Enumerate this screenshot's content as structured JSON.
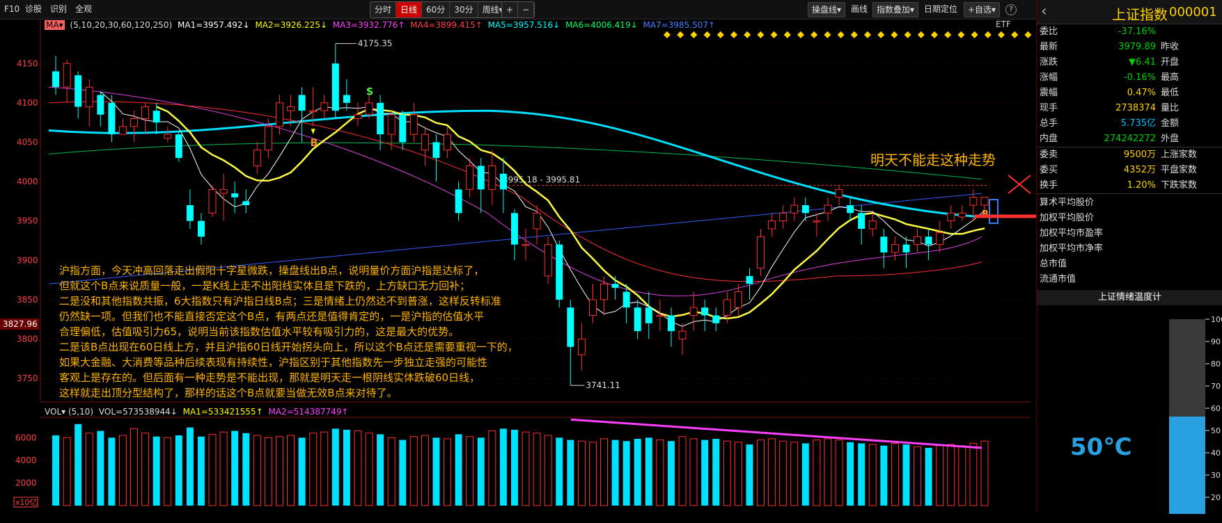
{
  "toolbar": {
    "f10": "F10",
    "diagnose": "诊股",
    "identify": "识别",
    "fullview": "全观",
    "periods": [
      "分时",
      "日线",
      "60分",
      "30分",
      "周线▾"
    ],
    "active_period": "日线",
    "zoom_in": "+",
    "zoom_out": "−",
    "caopan": "操盘线▾",
    "draw": "画线",
    "index_overlay": "指数叠加▾",
    "date_locate": "日期定位",
    "watchlist": "+自选▾",
    "help": "?"
  },
  "ma_line": {
    "selector": "MA▾",
    "periods": "(5,10,20,30,60,120,250)",
    "ma1": "MA1=3957.492↓",
    "ma2": "MA2=3926.225↓",
    "ma3": "MA3=3932.776↑",
    "ma4": "MA4=3899.415↑",
    "ma5": "MA5=3957.516↓",
    "ma6": "MA6=4006.419↓",
    "ma7": "MA7=3985.507↑",
    "etf": "ETF"
  },
  "chart_labels": {
    "high_label": "4175.35",
    "low_label": "3741.11",
    "gap_label": "3995.18 - 3995.81",
    "current_price_tag": "3827.96",
    "s_marker": "S",
    "b_marker": "B",
    "b_marker2": "B",
    "headline": "明天不能走这种走势"
  },
  "chart_data": [
    {
      "type": "candlestick",
      "title": "上证指数 日线",
      "ylim": [
        3720,
        4190
      ],
      "yticks": [
        3750,
        3800,
        3850,
        3900,
        3950,
        4000,
        4050,
        4100,
        4150
      ],
      "high_mark": 4175.35,
      "low_mark": 3741.11,
      "gap": [
        3995.18,
        3995.81
      ],
      "candles": [
        [
          4140,
          4120,
          4160,
          4110
        ],
        [
          4120,
          4150,
          4155,
          4100
        ],
        [
          4135,
          4095,
          4140,
          4080
        ],
        [
          4095,
          4120,
          4130,
          4070
        ],
        [
          4110,
          4085,
          4115,
          4070
        ],
        [
          4100,
          4060,
          4110,
          4050
        ],
        [
          4060,
          4070,
          4080,
          4060
        ],
        [
          4070,
          4080,
          4090,
          4050
        ],
        [
          4080,
          4095,
          4100,
          4060
        ],
        [
          4090,
          4075,
          4100,
          4060
        ],
        [
          4055,
          4060,
          4070,
          4050
        ],
        [
          4060,
          4030,
          4065,
          4025
        ],
        [
          3970,
          3950,
          3990,
          3940
        ],
        [
          3950,
          3930,
          3960,
          3920
        ],
        [
          3960,
          3990,
          3995,
          3955
        ],
        [
          3985,
          3990,
          4010,
          3950
        ],
        [
          3985,
          3980,
          4000,
          3960
        ],
        [
          3975,
          3970,
          3990,
          3960
        ],
        [
          4020,
          4040,
          4050,
          4010
        ],
        [
          4040,
          4070,
          4080,
          4030
        ],
        [
          4070,
          4100,
          4110,
          4060
        ],
        [
          4090,
          4095,
          4110,
          4070
        ],
        [
          4110,
          4090,
          4120,
          4050
        ],
        [
          4090,
          4090,
          4120,
          4070
        ],
        [
          4090,
          4100,
          4110,
          4080
        ],
        [
          4150,
          4090,
          4175,
          4080
        ],
        [
          4110,
          4100,
          4130,
          4090
        ],
        [
          4080,
          4085,
          4100,
          4070
        ],
        [
          4085,
          4100,
          4120,
          4080
        ],
        [
          4100,
          4060,
          4110,
          4040
        ],
        [
          4060,
          4085,
          4090,
          4040
        ],
        [
          4085,
          4050,
          4090,
          4040
        ],
        [
          4060,
          4085,
          4100,
          4050
        ],
        [
          4040,
          4060,
          4070,
          4020
        ],
        [
          4050,
          4030,
          4060,
          4000
        ],
        [
          4040,
          4060,
          4070,
          4030
        ],
        [
          3990,
          3960,
          4000,
          3950
        ],
        [
          3990,
          4020,
          4030,
          3980
        ],
        [
          4020,
          3990,
          4030,
          3960
        ],
        [
          3990,
          4020,
          4040,
          3970
        ],
        [
          4010,
          3990,
          4030,
          3960
        ],
        [
          3960,
          3920,
          3965,
          3900
        ],
        [
          3920,
          3920,
          3940,
          3900
        ],
        [
          3940,
          3960,
          3970,
          3920
        ],
        [
          3880,
          3920,
          3930,
          3870
        ],
        [
          3920,
          3850,
          3925,
          3840
        ],
        [
          3840,
          3790,
          3850,
          3741.11
        ],
        [
          3780,
          3800,
          3820,
          3760
        ],
        [
          3830,
          3850,
          3870,
          3820
        ],
        [
          3850,
          3870,
          3880,
          3830
        ],
        [
          3870,
          3865,
          3880,
          3850
        ],
        [
          3860,
          3840,
          3870,
          3820
        ],
        [
          3840,
          3810,
          3850,
          3800
        ],
        [
          3840,
          3820,
          3860,
          3800
        ],
        [
          3830,
          3830,
          3850,
          3810
        ],
        [
          3830,
          3810,
          3840,
          3790
        ],
        [
          3800,
          3810,
          3820,
          3780
        ],
        [
          3830,
          3840,
          3860,
          3810
        ],
        [
          3840,
          3830,
          3850,
          3810
        ],
        [
          3830,
          3820,
          3840,
          3810
        ],
        [
          3830,
          3850,
          3860,
          3820
        ],
        [
          3840,
          3860,
          3870,
          3830
        ],
        [
          3880,
          3870,
          3890,
          3850
        ],
        [
          3890,
          3930,
          3940,
          3880
        ],
        [
          3940,
          3950,
          3960,
          3930
        ],
        [
          3950,
          3960,
          3970,
          3940
        ],
        [
          3960,
          3970,
          3980,
          3950
        ],
        [
          3970,
          3960,
          3980,
          3950
        ],
        [
          3950,
          3950,
          3960,
          3930
        ],
        [
          3960,
          3970,
          3980,
          3950
        ],
        [
          3980,
          3990,
          3995,
          3970
        ],
        [
          3970,
          3960,
          3980,
          3950
        ],
        [
          3960,
          3940,
          3970,
          3920
        ],
        [
          3940,
          3950,
          3960,
          3930
        ],
        [
          3930,
          3910,
          3940,
          3890
        ],
        [
          3910,
          3920,
          3930,
          3900
        ],
        [
          3920,
          3910,
          3930,
          3890
        ],
        [
          3920,
          3930,
          3940,
          3910
        ],
        [
          3930,
          3920,
          3940,
          3900
        ],
        [
          3920,
          3935,
          3950,
          3910
        ],
        [
          3950,
          3960,
          3970,
          3940
        ],
        [
          3955,
          3960,
          3970,
          3950
        ],
        [
          3970,
          3980,
          3990,
          3950
        ],
        [
          3970,
          3980,
          3980,
          3960
        ]
      ]
    },
    {
      "type": "bar",
      "title": "VOL",
      "series_label": "VOL=573538944↓",
      "ma1": "MA1=533421555↑",
      "ma2": "MA2=514387749↑",
      "ylim": [
        0,
        7800
      ],
      "yticks": [
        2000,
        4000,
        6000
      ],
      "unit_label": "x10亿",
      "values": [
        6200,
        6000,
        7200,
        6400,
        6600,
        6000,
        6200,
        6800,
        6400,
        6100,
        6000,
        6200,
        6900,
        6100,
        6300,
        6500,
        6600,
        6400,
        6200,
        6000,
        6100,
        6200,
        6000,
        6400,
        6500,
        6800,
        6700,
        6600,
        6400,
        6300,
        6000,
        5800,
        6100,
        6200,
        6000,
        5900,
        6300,
        6100,
        6000,
        6600,
        6800,
        6700,
        6500,
        6400,
        6200,
        6000,
        5800,
        5700,
        5600,
        5900,
        5800,
        5700,
        5900,
        6000,
        5800,
        5700,
        6100,
        5900,
        5800,
        5900,
        5700,
        5600,
        5400,
        5800,
        5900,
        5700,
        5600,
        5500,
        5800,
        5900,
        5800,
        5600,
        5500,
        5400,
        5300,
        5500,
        5400,
        5200,
        5100,
        5300,
        5400,
        5300,
        5500,
        5700
      ]
    }
  ],
  "annotation": [
    "沪指方面，今天冲高回落走出假阳十字星微跌，操盘线出B点，说明量价方面沪指是达标了，",
    "但就这个B点来说质量一般，一是K线上走不出阳线实体且是下跌的，上方缺口无力回补；",
    "二是没和其他指数共振，6大指数只有沪指日线B点；三是情绪上仍然达不到普涨，这样反转标准",
    "仍然缺一项。但我们也不能直接否定这个B点，有两点还是值得肯定的，一是沪指的估值水平",
    "合理偏低，估值吸引力65，说明当前该指数估值水平较有吸引力的，这是最大的优势。",
    "二是该B点出现在60日线上方，并且沪指60日线开始拐头向上，所以这个B点还是需要重视一下的，",
    "如果大金融、大消费等品种后续表现有持续性，沪指区别于其他指数先一步独立走强的可能性",
    "客观上是存在的。但后面有一种走势是不能出现，那就是明天走一根阴线实体跌破60日线，",
    "这样就走出顶分型结构了，那样的话这个B点就要当做无效B点来对待了。"
  ],
  "right_panel": {
    "title": "上证指数",
    "code": "000001",
    "rows": [
      {
        "label": "委比",
        "value": "-37.16%",
        "color": "#00d000",
        "right": ""
      },
      {
        "label": "最新",
        "value": "3979.89",
        "color": "#00d000",
        "right": "昨收"
      },
      {
        "label": "涨跌",
        "value": "▼6.41",
        "color": "#00d000",
        "right": "开盘"
      },
      {
        "label": "涨幅",
        "value": "-0.16%",
        "color": "#00d000",
        "right": "最高"
      },
      {
        "label": "震幅",
        "value": "0.47%",
        "color": "#ffd200",
        "right": "最低"
      },
      {
        "label": "现手",
        "value": "2738374",
        "color": "#ffd200",
        "right": "量比"
      },
      {
        "label": "总手",
        "value": "5.735亿",
        "color": "#00c0ff",
        "right": "金额"
      },
      {
        "label": "内盘",
        "value": "274242272",
        "color": "#00d000",
        "right": "外盘"
      }
    ],
    "rows2": [
      {
        "label": "委卖",
        "value": "9500万",
        "color": "#ffd200",
        "right": "上涨家数"
      },
      {
        "label": "委买",
        "value": "4352万",
        "color": "#ffd200",
        "right": "平盘家数"
      },
      {
        "label": "换手",
        "value": "1.20%",
        "color": "#ffd200",
        "right": "下跌家数"
      }
    ],
    "list": [
      "算术平均股价",
      "加权平均股价",
      "加权平均市盈率",
      "加权平均市净率",
      "总市值",
      "流通市值"
    ],
    "thermo_title": "上证情绪温度计",
    "thermo_value": "50℃",
    "thermo_level": 0.5,
    "thermo_ticks": [
      "100",
      "90",
      "80",
      "70",
      "60",
      "50",
      "40",
      "30",
      "20"
    ]
  }
}
